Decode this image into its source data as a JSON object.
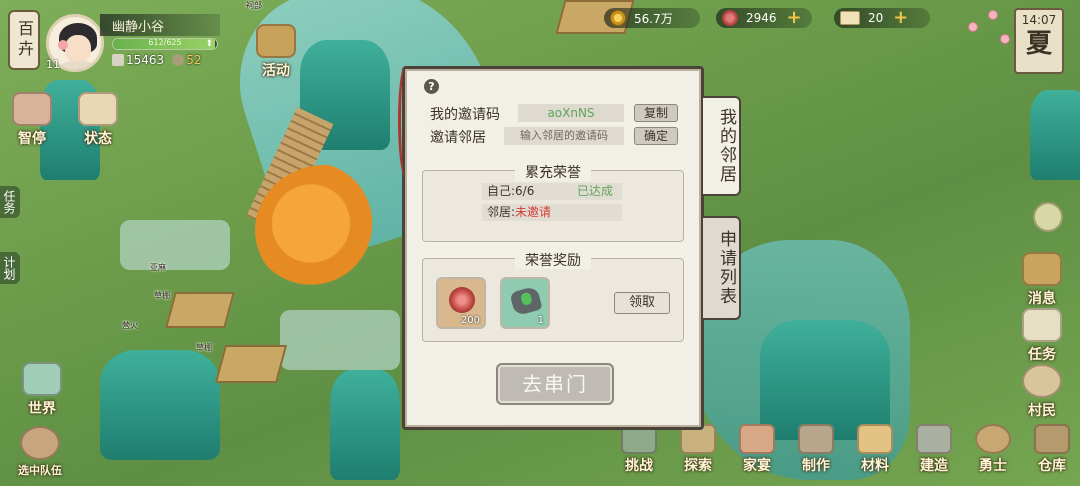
{
  "player": {
    "side_title": "百卉",
    "name": "幽静小谷",
    "level": "11",
    "exp_text": "612/625",
    "exp_fraction": 0.98,
    "stat_a": "15463",
    "stat_b": "52"
  },
  "resources": {
    "coins": "56.7万",
    "jade": "2946",
    "tickets": "20"
  },
  "clock": {
    "time": "14:07",
    "season": "夏"
  },
  "event_button": "活动",
  "left_menu": [
    {
      "label": "智停"
    },
    {
      "label": "状态"
    },
    {
      "label": "世界"
    },
    {
      "label": "选中队伍"
    }
  ],
  "left_tabs": {
    "tasks": "任务",
    "plan": "计划"
  },
  "right_menu": [
    {
      "label": "消息"
    },
    {
      "label": "任务"
    },
    {
      "label": "村民"
    }
  ],
  "bottom_menu": [
    {
      "label": "挑战"
    },
    {
      "label": "探索"
    },
    {
      "label": "家宴"
    },
    {
      "label": "制作"
    },
    {
      "label": "材料"
    },
    {
      "label": "建造"
    },
    {
      "label": "勇士"
    },
    {
      "label": "仓库"
    }
  ],
  "scene_labels": {
    "hall": "祠部",
    "fire": "营火",
    "shed1": "草棚",
    "shed2": "草棚",
    "crop": "亚麻"
  },
  "dialog": {
    "help": "?",
    "my_code_label": "我的邀请码",
    "my_code_value": "aoXnNS",
    "copy_button": "复制",
    "invite_label": "邀请邻居",
    "invite_placeholder": "输入邻居的邀请码",
    "confirm_button": "确定",
    "honor_title": "累充荣誉",
    "self_line": "自己:6/6",
    "self_status": "已达成",
    "neighbor_line": "邻居:",
    "neighbor_status": "未邀请",
    "reward_title": "荣誉奖励",
    "rewards": [
      {
        "icon": "red-gem-icon",
        "qty": "200"
      },
      {
        "icon": "jade-stone-icon",
        "qty": "1"
      }
    ],
    "claim_button": "领取",
    "visit_button": "去串门"
  },
  "side_tabs": {
    "neighbors": "我的邻居",
    "requests": "申请列表"
  },
  "colors": {
    "panel_bg": "#f2efe6",
    "reached": "#5fa55c",
    "not_invited": "#d23c36",
    "gold": "#f2c44a"
  }
}
